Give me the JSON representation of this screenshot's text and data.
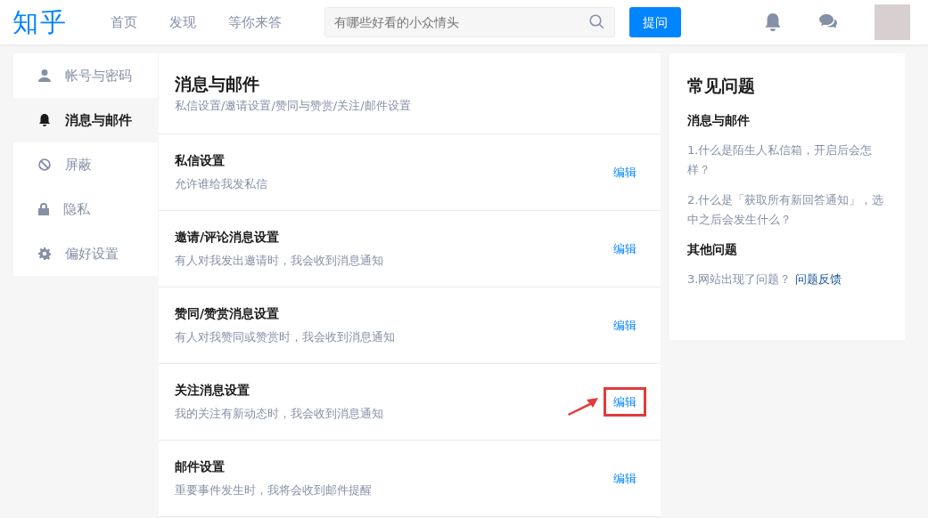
{
  "header": {
    "logo": "知乎",
    "nav": [
      {
        "label": "首页"
      },
      {
        "label": "发现"
      },
      {
        "label": "等你来答"
      }
    ],
    "search": {
      "placeholder": "有哪些好看的小众情头"
    },
    "ask_button": "提问"
  },
  "sidebar": {
    "items": [
      {
        "label": "帐号与密码",
        "kind": "user",
        "selected": false
      },
      {
        "label": "消息与邮件",
        "kind": "bell",
        "selected": true
      },
      {
        "label": "屏蔽",
        "kind": "block",
        "selected": false
      },
      {
        "label": "隐私",
        "kind": "lock",
        "selected": false
      },
      {
        "label": "偏好设置",
        "kind": "gear",
        "selected": false
      }
    ]
  },
  "section": {
    "title": "消息与邮件",
    "subtitle": "私信设置/邀请设置/赞同与赞赏/关注/邮件设置"
  },
  "settings": [
    {
      "title": "私信设置",
      "description": "允许谁给我发私信",
      "action": "编辑",
      "annotated": false
    },
    {
      "title": "邀请/评论消息设置",
      "description": "有人对我发出邀请时，我会收到消息通知",
      "action": "编辑",
      "annotated": false
    },
    {
      "title": "赞同/赞赏消息设置",
      "description": "有人对我赞同或赞赏时，我会收到消息通知",
      "action": "编辑",
      "annotated": false
    },
    {
      "title": "关注消息设置",
      "description": "我的关注有新动态时，我会收到消息通知",
      "action": "编辑",
      "annotated": true
    },
    {
      "title": "邮件设置",
      "description": "重要事件发生时，我将会收到邮件提醒",
      "action": "编辑",
      "annotated": false
    }
  ],
  "faq": {
    "title": "常见问题",
    "groups": [
      {
        "heading": "消息与邮件",
        "items": [
          {
            "text": "1.什么是陌生人私信箱，开启后会怎样？"
          },
          {
            "text": "2.什么是「获取所有新回答通知」，选中之后会发生什么？"
          }
        ]
      },
      {
        "heading": "其他问题",
        "items": [
          {
            "text": "3.网站出现了问题？",
            "link": "问题反馈"
          }
        ]
      }
    ]
  }
}
